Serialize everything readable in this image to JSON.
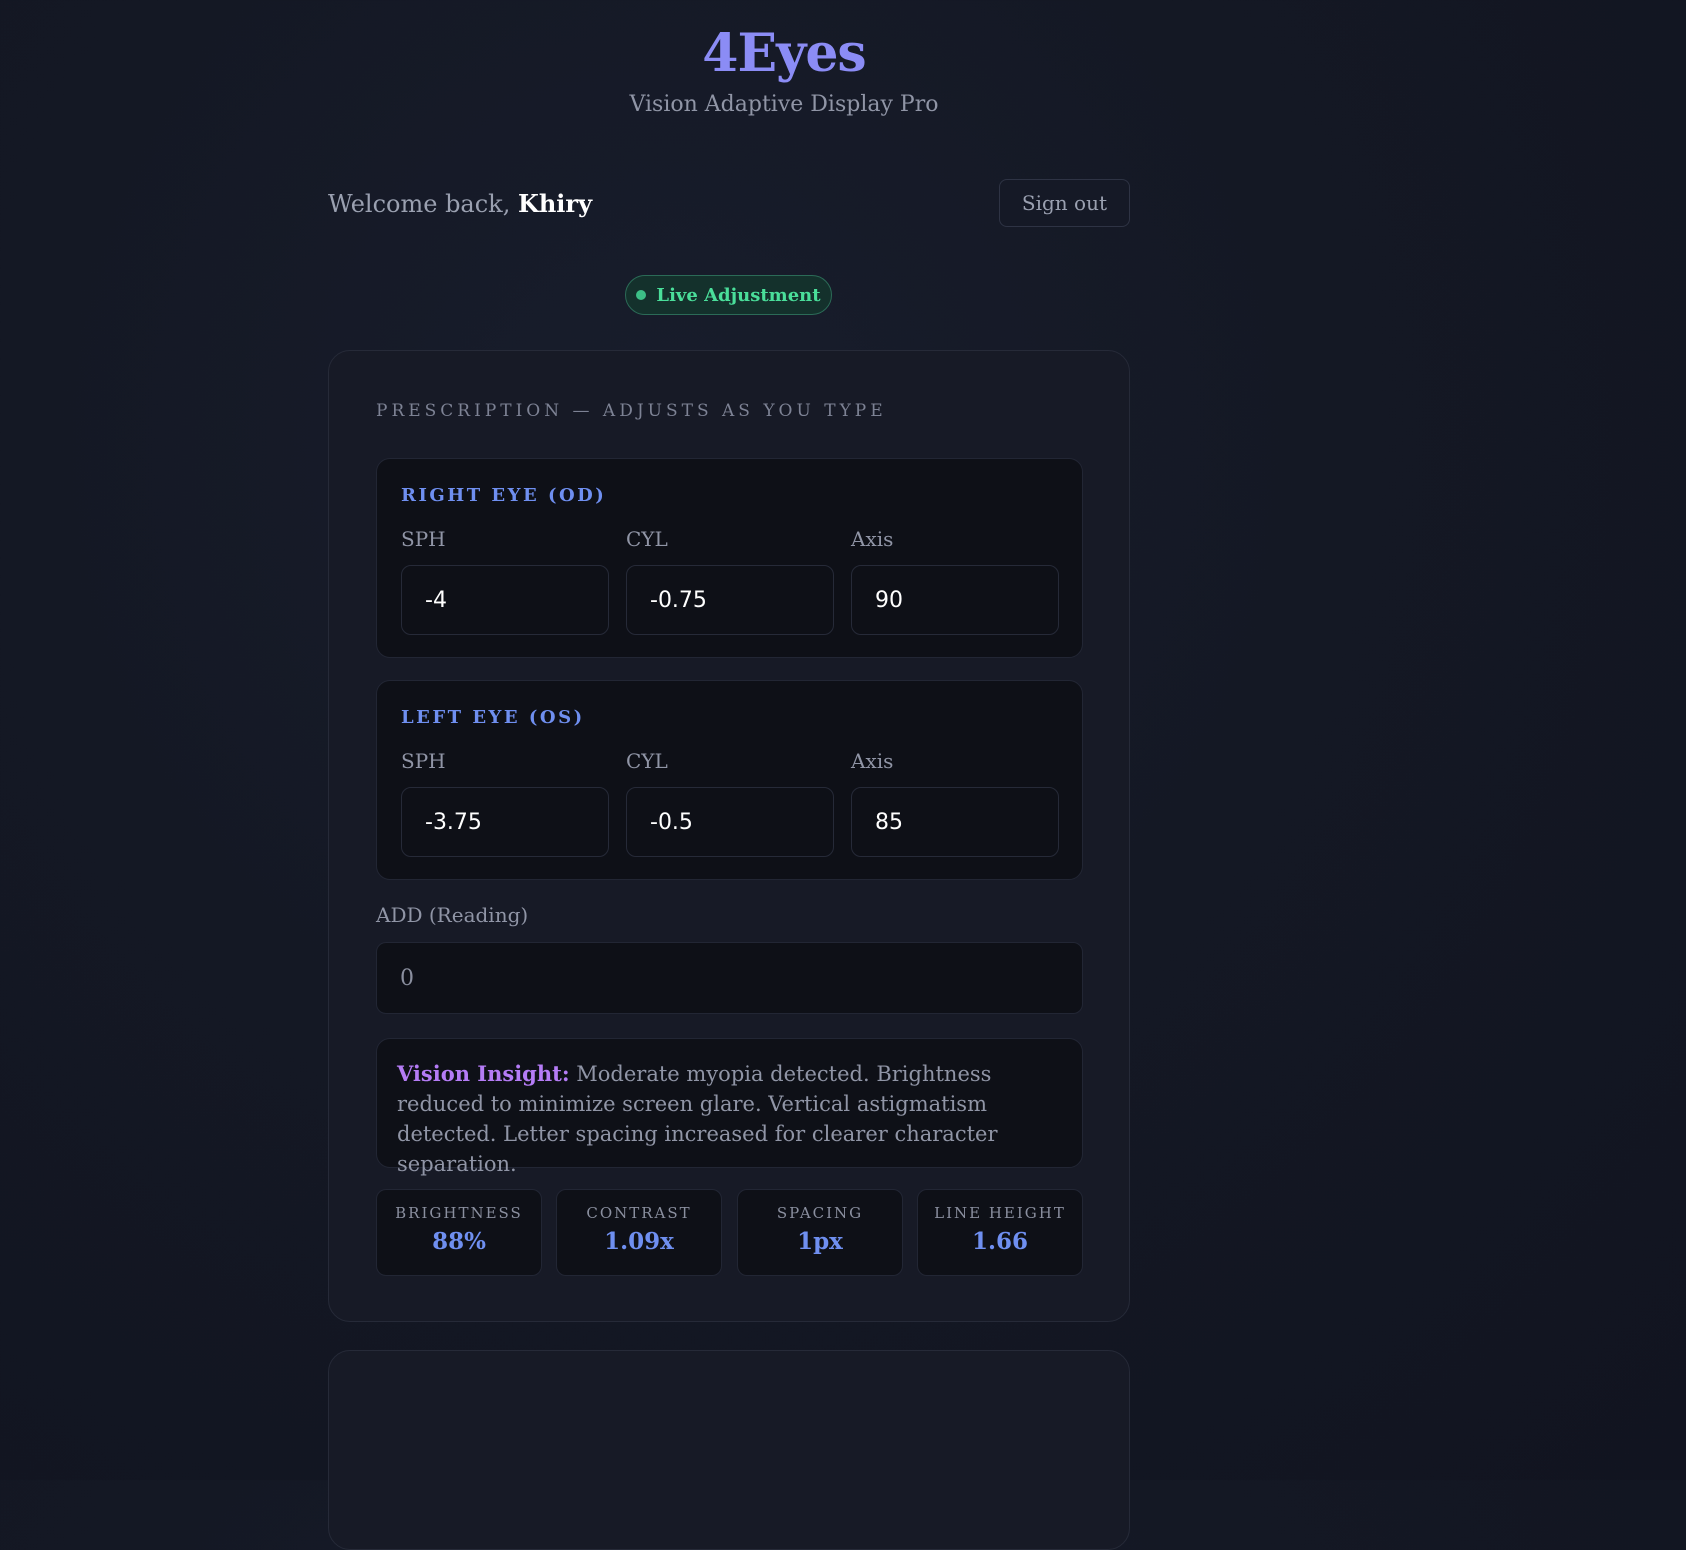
{
  "header": {
    "title": "4Eyes",
    "subtitle": "Vision Adaptive Display Pro"
  },
  "user": {
    "welcome_prefix": "Welcome back,",
    "name": "Khiry",
    "signout_label": "Sign out"
  },
  "status": {
    "live_label": "Live Adjustment"
  },
  "prescription": {
    "heading": "PRESCRIPTION — ADJUSTS AS YOU TYPE",
    "right_eye": {
      "title": "RIGHT EYE (OD)",
      "sph_label": "SPH",
      "cyl_label": "CYL",
      "axis_label": "Axis",
      "sph": "-4",
      "cyl": "-0.75",
      "axis": "90"
    },
    "left_eye": {
      "title": "LEFT EYE (OS)",
      "sph_label": "SPH",
      "cyl_label": "CYL",
      "axis_label": "Axis",
      "sph": "-3.75",
      "cyl": "-0.5",
      "axis": "85"
    },
    "add_label": "ADD (Reading)",
    "add_value": "0"
  },
  "insight": {
    "label": "Vision Insight:",
    "text": "Moderate myopia detected. Brightness reduced to minimize screen glare. Vertical astigmatism detected. Letter spacing increased for clearer character separation."
  },
  "stats": [
    {
      "label": "BRIGHTNESS",
      "value": "88%"
    },
    {
      "label": "CONTRAST",
      "value": "1.09x"
    },
    {
      "label": "SPACING",
      "value": "1px"
    },
    {
      "label": "LINE HEIGHT",
      "value": "1.66"
    }
  ],
  "colors": {
    "accent": "#6f8ff0",
    "title": "#8b8cf5",
    "live": "#4ade9a",
    "insight": "#b57cf6",
    "background": "#141824"
  }
}
